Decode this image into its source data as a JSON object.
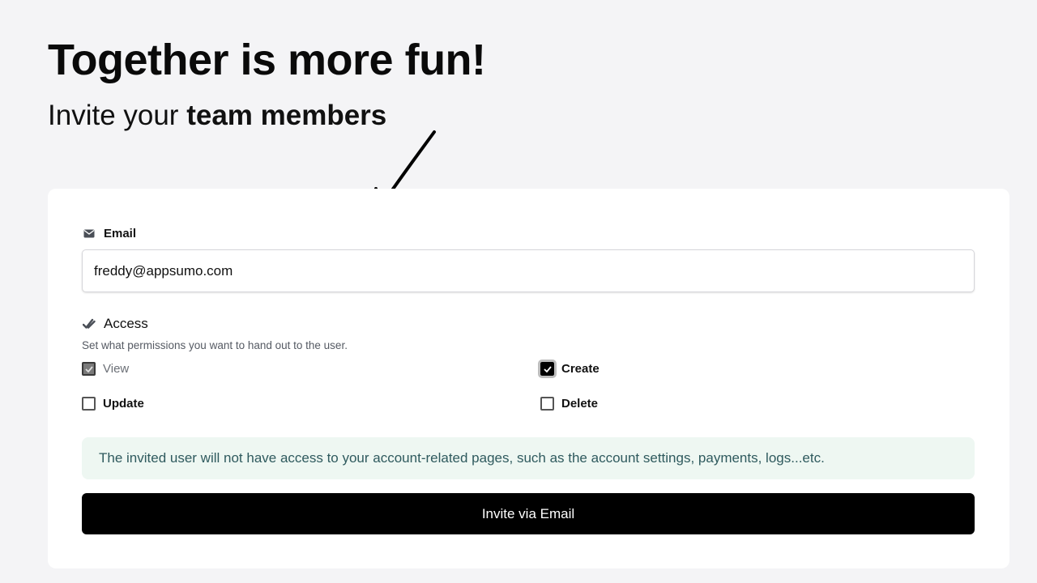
{
  "hero": {
    "title": "Together is more fun!",
    "subtitle_prefix": "Invite your ",
    "subtitle_bold": "team members"
  },
  "form": {
    "email_label": "Email",
    "email_value": "freddy@appsumo.com",
    "access_label": "Access",
    "access_help": "Set what permissions you want to hand out to the user.",
    "permissions": [
      {
        "label": "View",
        "checked": true,
        "disabled": true
      },
      {
        "label": "Create",
        "checked": true,
        "disabled": false
      },
      {
        "label": "Update",
        "checked": false,
        "disabled": false
      },
      {
        "label": "Delete",
        "checked": false,
        "disabled": false
      }
    ],
    "notice": "The invited user will not have access to your account-related pages, such as the account settings, payments, logs...etc.",
    "submit_label": "Invite via Email"
  },
  "icons": {
    "email": "envelope-icon",
    "access": "double-check-icon",
    "arrow": "hand-drawn-arrow-icon"
  },
  "colors": {
    "background": "#f4f4f6",
    "card": "#ffffff",
    "button": "#000000",
    "notice_bg": "#eef7f2",
    "notice_text": "#2f5a5e"
  }
}
